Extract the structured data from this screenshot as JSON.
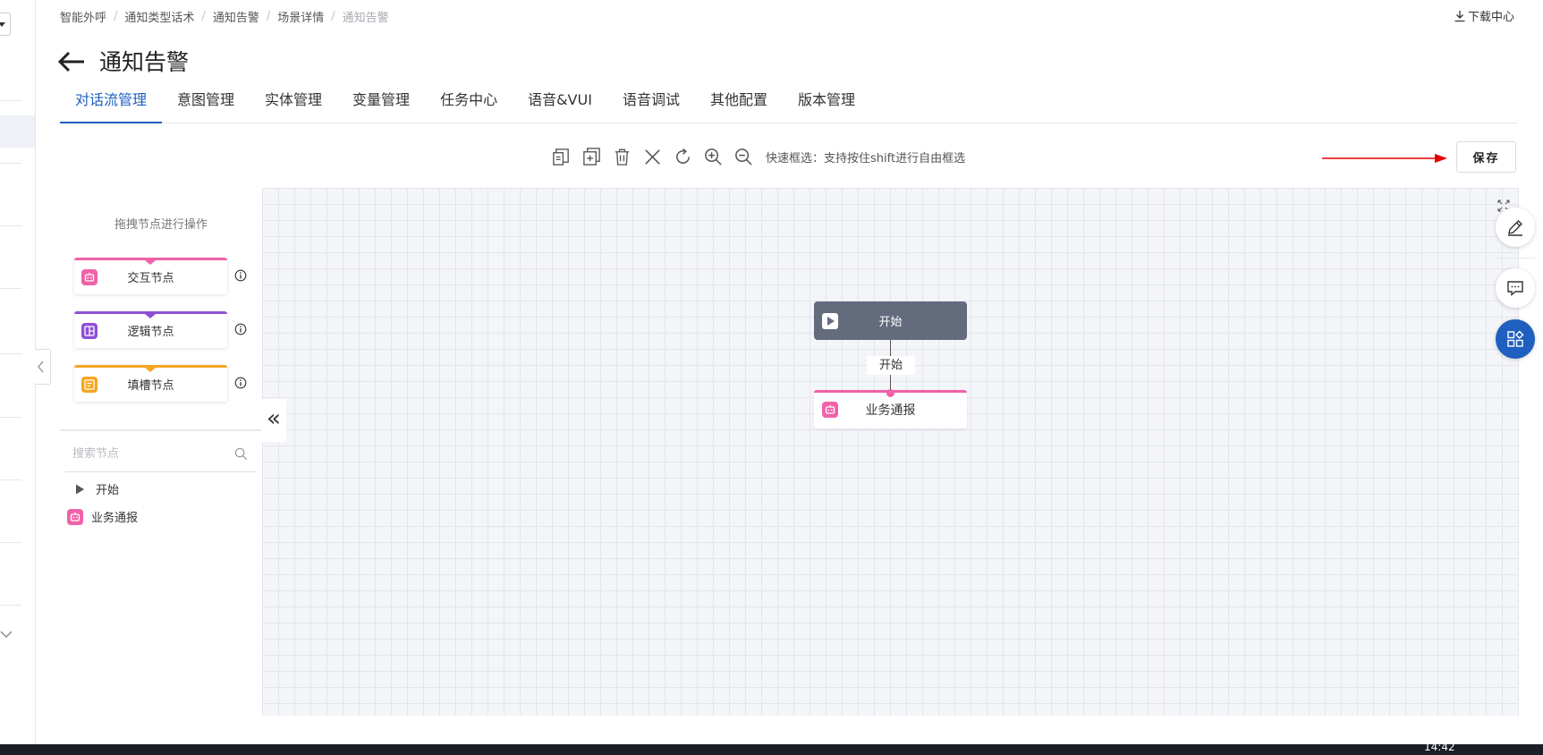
{
  "breadcrumb": {
    "items": [
      "智能外呼",
      "通知类型话术",
      "通知告警",
      "场景详情"
    ],
    "current": "通知告警"
  },
  "header": {
    "download_label": "下载中心",
    "title": "通知告警"
  },
  "tabs": [
    {
      "label": "对话流管理",
      "active": true
    },
    {
      "label": "意图管理"
    },
    {
      "label": "实体管理"
    },
    {
      "label": "变量管理"
    },
    {
      "label": "任务中心"
    },
    {
      "label": "语音&VUI"
    },
    {
      "label": "语音调试"
    },
    {
      "label": "其他配置"
    },
    {
      "label": "版本管理"
    }
  ],
  "toolbar": {
    "icons": [
      "copy-icon",
      "add-copy-icon",
      "trash-icon",
      "close-icon",
      "refresh-icon",
      "zoom-in-icon",
      "zoom-out-icon"
    ],
    "hint": "快速框选：支持按住shift进行自由框选",
    "save_label": "保存"
  },
  "panel": {
    "title": "拖拽节点进行操作",
    "nodes": [
      {
        "label": "交互节点",
        "color": "#f062a8"
      },
      {
        "label": "逻辑节点",
        "color": "#8e4fd6"
      },
      {
        "label": "填槽节点",
        "color": "#f5a623"
      }
    ],
    "search": {
      "placeholder": "搜索节点",
      "value": ""
    },
    "tree": [
      {
        "label": "开始",
        "icon": "play-icon"
      },
      {
        "label": "业务通报",
        "icon": "robot-icon",
        "color": "#f062a8"
      }
    ]
  },
  "canvas": {
    "start_node": {
      "label": "开始"
    },
    "edge_label": "开始",
    "biz_node": {
      "label": "业务通报"
    }
  },
  "colors": {
    "primary": "#1f5fbf",
    "interactive_node": "#f062a8",
    "logic_node": "#8e4fd6",
    "slot_node": "#f5a623",
    "start_node": "#636b7d",
    "annotation_arrow": "#e60000"
  },
  "taskbar": {
    "time": "14:42"
  }
}
